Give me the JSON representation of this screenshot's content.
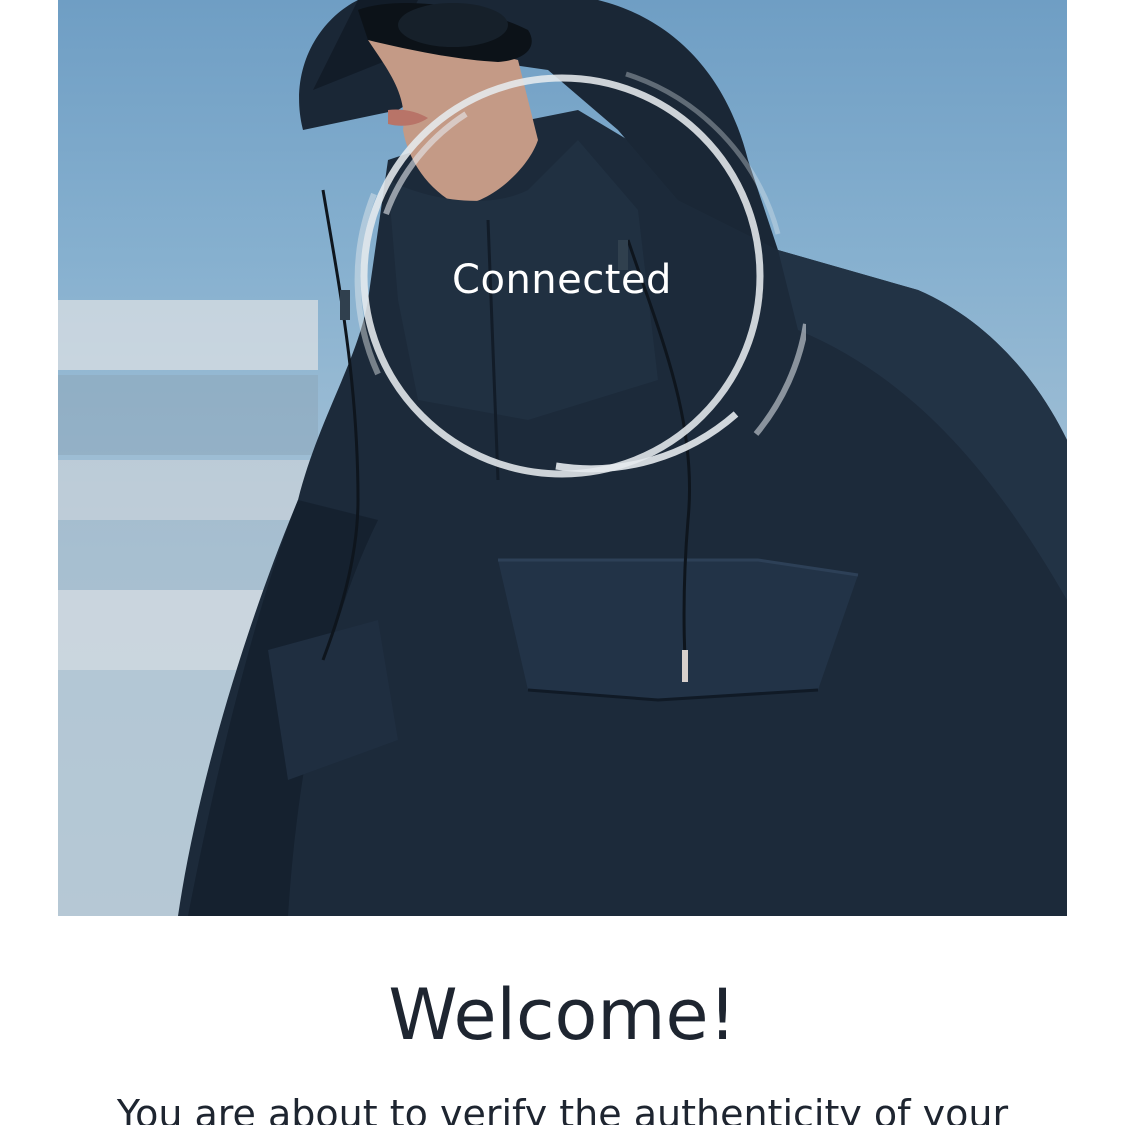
{
  "hero": {
    "image_alt": "Model wearing a dark navy hooded jacket with goggles against a blue sky",
    "status_text": "Connected"
  },
  "welcome": {
    "title": "Welcome!",
    "body": "You are about to verify the authenticity of your"
  },
  "colors": {
    "jacket": "#1c2a3a",
    "sky": "#86b0cf",
    "text_dark": "#1e2530",
    "ring": "#e6eaee"
  }
}
